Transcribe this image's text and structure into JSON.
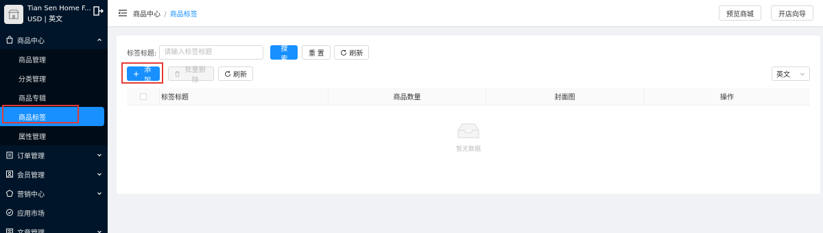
{
  "shop": {
    "name": "Tian Sen Home F...",
    "currency_lang": "USD | 英文"
  },
  "sidebar": {
    "groups": [
      {
        "label": "商品中心",
        "icon": "bag-icon",
        "expanded": true,
        "items": [
          {
            "label": "商品管理"
          },
          {
            "label": "分类管理"
          },
          {
            "label": "商品专辑"
          },
          {
            "label": "商品标签",
            "active": true
          },
          {
            "label": "属性管理"
          }
        ]
      },
      {
        "label": "订单管理",
        "icon": "clipboard-icon"
      },
      {
        "label": "会员管理",
        "icon": "member-icon"
      },
      {
        "label": "营销中心",
        "icon": "marketing-icon"
      },
      {
        "label": "应用市场",
        "icon": "app-market-icon"
      },
      {
        "label": "文章管理",
        "icon": "article-icon"
      }
    ]
  },
  "header": {
    "breadcrumb_parent": "商品中心",
    "breadcrumb_sep": "/",
    "breadcrumb_current": "商品标签",
    "preview_label": "预览商城",
    "guide_label": "开店向导"
  },
  "search": {
    "label": "标签标题:",
    "placeholder": "请输入标签标题",
    "value": "",
    "search_btn": "搜 索",
    "reset_btn": "重 置",
    "refresh_btn": "刷新"
  },
  "actions": {
    "add_btn": "添加",
    "batch_delete_btn": "批量删除",
    "refresh_btn": "刷新",
    "lang_selected": "英文"
  },
  "table": {
    "columns": [
      "标签标题",
      "商品数量",
      "封面图",
      "操作"
    ],
    "rows": [],
    "empty_text": "暂无数据"
  },
  "colors": {
    "sidebar_bg": "#001529",
    "accent": "#1890ff",
    "highlight_border": "#e53935"
  }
}
